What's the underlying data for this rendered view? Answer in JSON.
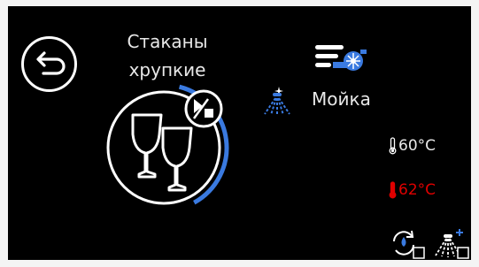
{
  "program": {
    "title_line1": "Стаканы",
    "title_line2": "хрупкие",
    "icon": "wine-glasses-icon",
    "progress_fraction": 0.38
  },
  "phase": {
    "label": "Мойка",
    "icon": "spray-icon"
  },
  "temperatures": {
    "target": "60°C",
    "actual": "62°C",
    "actual_color": "#e00000"
  },
  "icons": {
    "back": "back-arrow-icon",
    "play_stop": "play-stop-icon",
    "pump": "pump-icon",
    "rinse": "rinse-cycle-icon",
    "spray_plus": "spray-plus-icon"
  },
  "colors": {
    "accent": "#3a7ae0",
    "background": "#000000",
    "text": "#e8e8e8"
  }
}
